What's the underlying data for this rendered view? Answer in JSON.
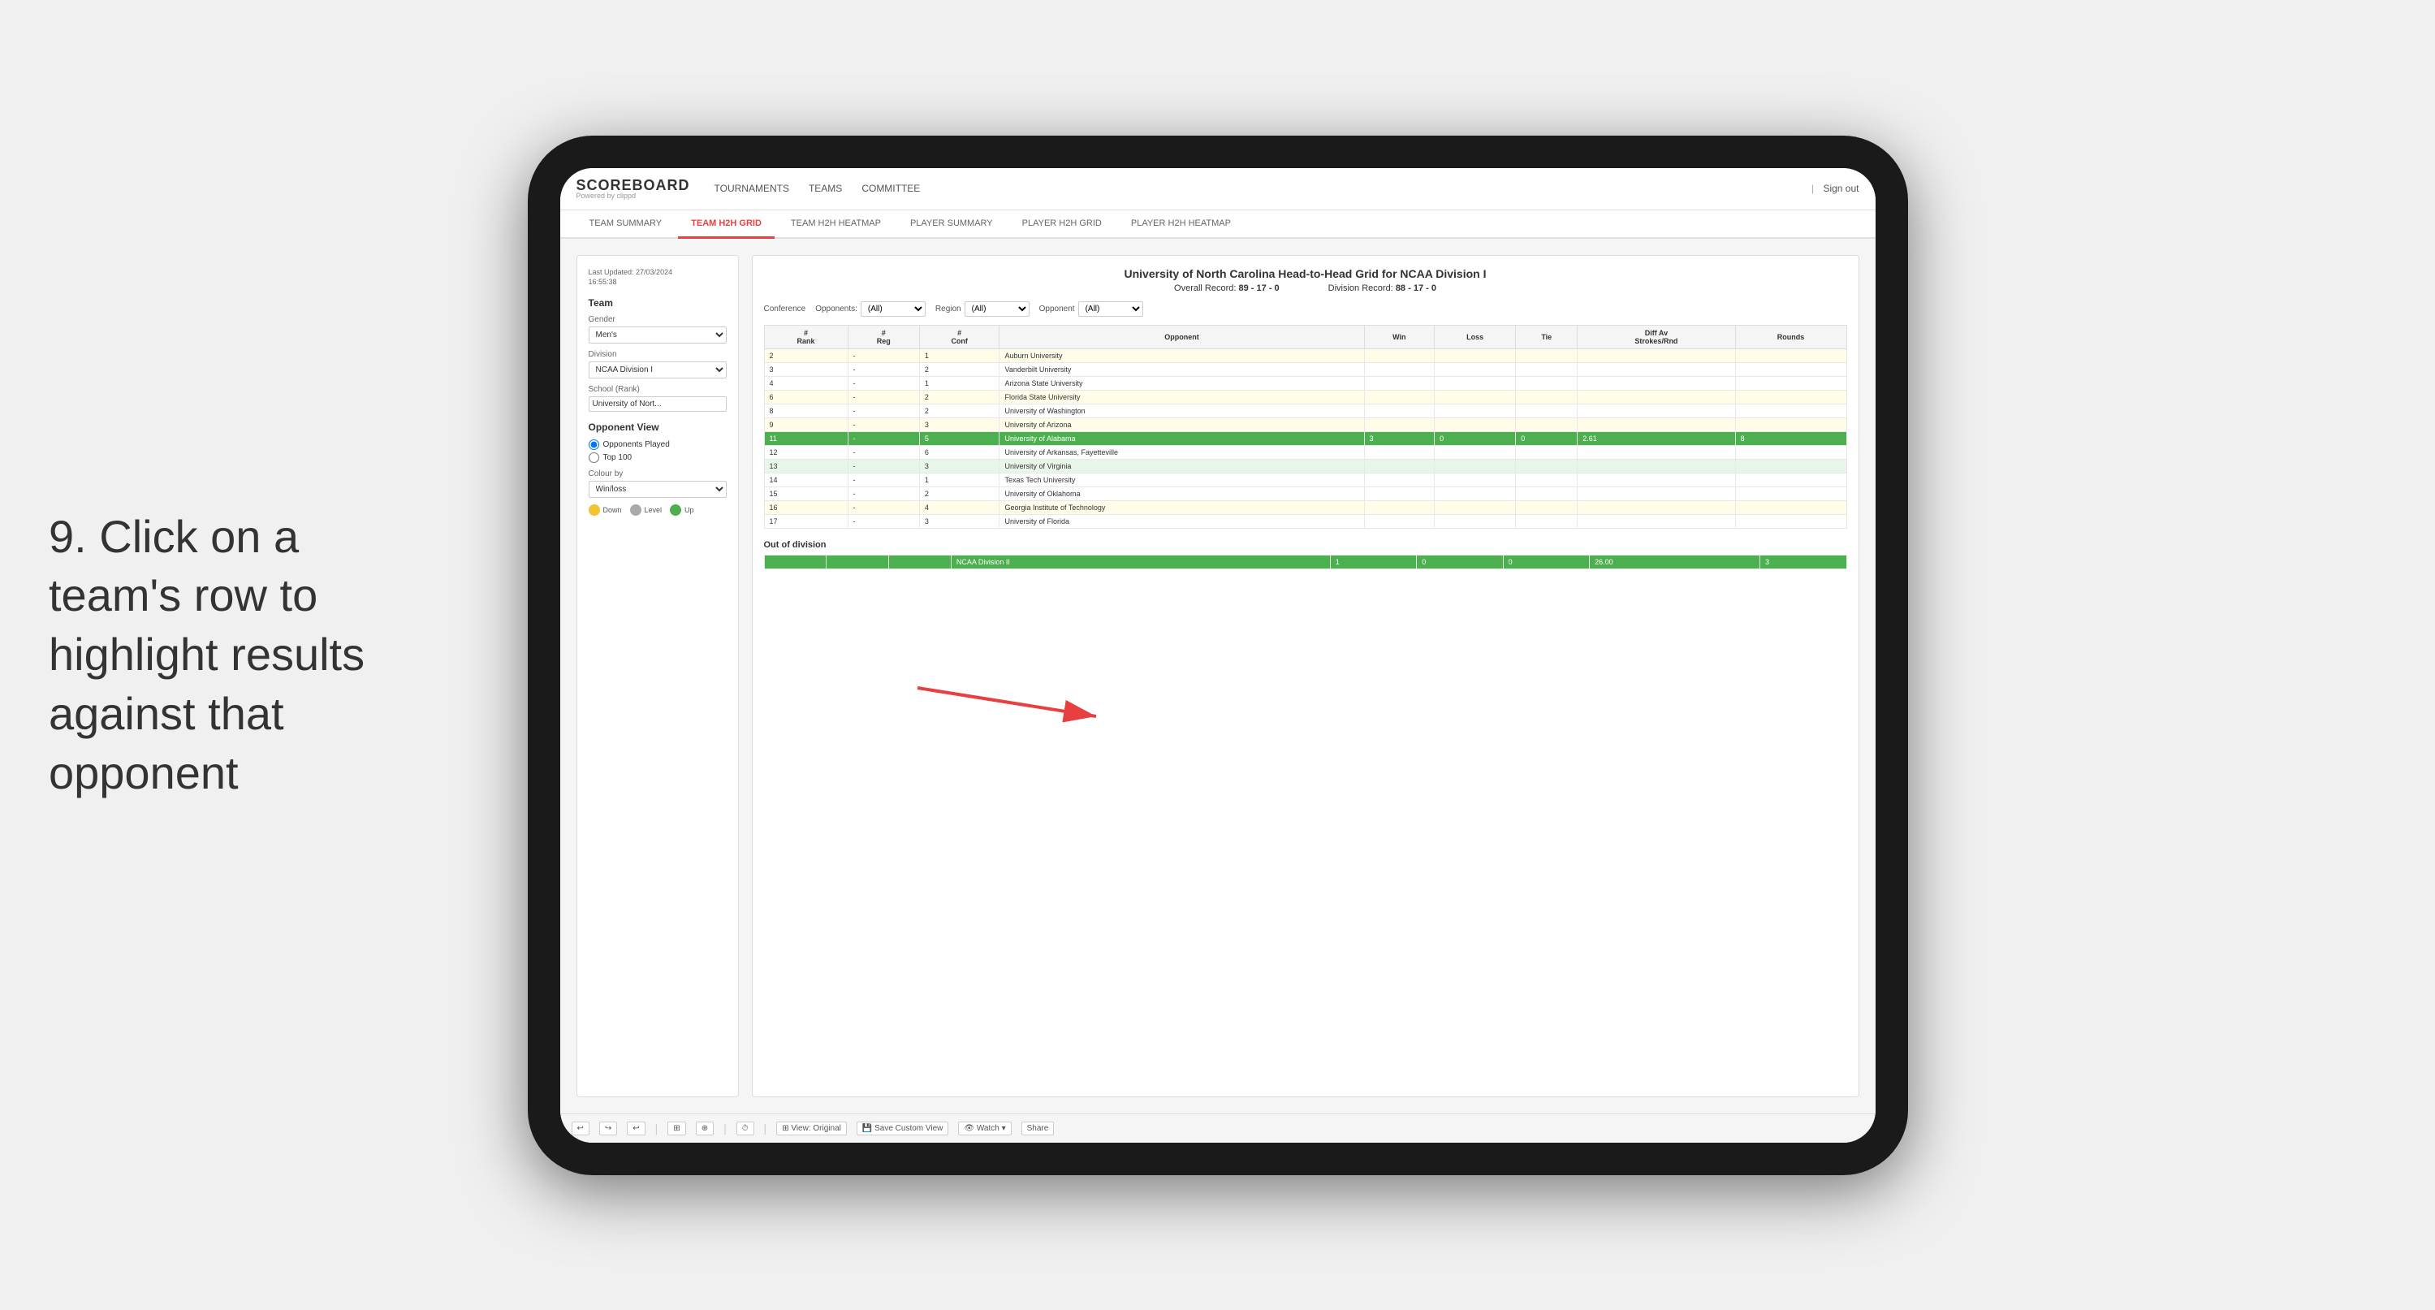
{
  "instruction": {
    "step": "9.",
    "text": "Click on a team's row to highlight results against that opponent"
  },
  "app": {
    "logo": "SCOREBOARD",
    "logo_powered": "Powered by clippd",
    "nav_items": [
      "TOURNAMENTS",
      "TEAMS",
      "COMMITTEE"
    ],
    "sign_out_separator": "|",
    "sign_out_label": "Sign out"
  },
  "sub_tabs": [
    {
      "label": "TEAM SUMMARY",
      "active": false
    },
    {
      "label": "TEAM H2H GRID",
      "active": true
    },
    {
      "label": "TEAM H2H HEATMAP",
      "active": false
    },
    {
      "label": "PLAYER SUMMARY",
      "active": false
    },
    {
      "label": "PLAYER H2H GRID",
      "active": false
    },
    {
      "label": "PLAYER H2H HEATMAP",
      "active": false
    }
  ],
  "left_panel": {
    "last_updated_label": "Last Updated: 27/03/2024",
    "last_updated_time": "16:55:38",
    "team_label": "Team",
    "gender_label": "Gender",
    "gender_value": "Men's",
    "division_label": "Division",
    "division_value": "NCAA Division I",
    "school_rank_label": "School (Rank)",
    "school_rank_value": "University of Nort...",
    "opponent_view_label": "Opponent View",
    "radio_opponents": "Opponents Played",
    "radio_top100": "Top 100",
    "colour_by_label": "Colour by",
    "colour_by_value": "Win/loss",
    "legend_down": "Down",
    "legend_level": "Level",
    "legend_up": "Up",
    "legend_down_color": "#f4c430",
    "legend_level_color": "#aaaaaa",
    "legend_up_color": "#4caf50"
  },
  "grid": {
    "title": "University of North Carolina Head-to-Head Grid for NCAA Division I",
    "overall_record_label": "Overall Record:",
    "overall_record": "89 - 17 - 0",
    "division_record_label": "Division Record:",
    "division_record": "88 - 17 - 0",
    "filter_opponents_label": "Opponents:",
    "filter_opponents_value": "(All)",
    "filter_region_label": "Region",
    "filter_region_value": "(All)",
    "filter_opponent_label": "Opponent",
    "filter_opponent_value": "(All)",
    "table_headers": [
      "#\nRank",
      "#\nReg",
      "#\nConf",
      "Opponent",
      "Win",
      "Loss",
      "Tie",
      "Diff Av\nStrokes/Rnd",
      "Rounds"
    ],
    "rows": [
      {
        "rank": "2",
        "reg": "-",
        "conf": "1",
        "opponent": "Auburn University",
        "win": "",
        "loss": "",
        "tie": "",
        "diff": "",
        "rounds": "",
        "highlight": "light-yellow"
      },
      {
        "rank": "3",
        "reg": "-",
        "conf": "2",
        "opponent": "Vanderbilt University",
        "win": "",
        "loss": "",
        "tie": "",
        "diff": "",
        "rounds": "",
        "highlight": "none"
      },
      {
        "rank": "4",
        "reg": "-",
        "conf": "1",
        "opponent": "Arizona State University",
        "win": "",
        "loss": "",
        "tie": "",
        "diff": "",
        "rounds": "",
        "highlight": "none"
      },
      {
        "rank": "6",
        "reg": "-",
        "conf": "2",
        "opponent": "Florida State University",
        "win": "",
        "loss": "",
        "tie": "",
        "diff": "",
        "rounds": "",
        "highlight": "light-yellow"
      },
      {
        "rank": "8",
        "reg": "-",
        "conf": "2",
        "opponent": "University of Washington",
        "win": "",
        "loss": "",
        "tie": "",
        "diff": "",
        "rounds": "",
        "highlight": "none"
      },
      {
        "rank": "9",
        "reg": "-",
        "conf": "3",
        "opponent": "University of Arizona",
        "win": "",
        "loss": "",
        "tie": "",
        "diff": "",
        "rounds": "",
        "highlight": "light-yellow"
      },
      {
        "rank": "11",
        "reg": "-",
        "conf": "5",
        "opponent": "University of Alabama",
        "win": "3",
        "loss": "0",
        "tie": "0",
        "diff": "2.61",
        "rounds": "8",
        "highlight": "green"
      },
      {
        "rank": "12",
        "reg": "-",
        "conf": "6",
        "opponent": "University of Arkansas, Fayetteville",
        "win": "",
        "loss": "",
        "tie": "",
        "diff": "",
        "rounds": "",
        "highlight": "none"
      },
      {
        "rank": "13",
        "reg": "-",
        "conf": "3",
        "opponent": "University of Virginia",
        "win": "",
        "loss": "",
        "tie": "",
        "diff": "",
        "rounds": "",
        "highlight": "light-green"
      },
      {
        "rank": "14",
        "reg": "-",
        "conf": "1",
        "opponent": "Texas Tech University",
        "win": "",
        "loss": "",
        "tie": "",
        "diff": "",
        "rounds": "",
        "highlight": "none"
      },
      {
        "rank": "15",
        "reg": "-",
        "conf": "2",
        "opponent": "University of Oklahoma",
        "win": "",
        "loss": "",
        "tie": "",
        "diff": "",
        "rounds": "",
        "highlight": "none"
      },
      {
        "rank": "16",
        "reg": "-",
        "conf": "4",
        "opponent": "Georgia Institute of Technology",
        "win": "",
        "loss": "",
        "tie": "",
        "diff": "",
        "rounds": "",
        "highlight": "light-yellow"
      },
      {
        "rank": "17",
        "reg": "-",
        "conf": "3",
        "opponent": "University of Florida",
        "win": "",
        "loss": "",
        "tie": "",
        "diff": "",
        "rounds": "",
        "highlight": "none"
      }
    ],
    "out_of_division_label": "Out of division",
    "out_row": {
      "name": "NCAA Division II",
      "win": "1",
      "loss": "0",
      "tie": "0",
      "diff": "26.00",
      "rounds": "3"
    }
  },
  "toolbar": {
    "undo_label": "↩",
    "redo_label": "↪",
    "view_label": "⊞ View: Original",
    "save_label": "💾 Save Custom View",
    "watch_label": "👁 Watch ▾",
    "share_label": "Share"
  }
}
